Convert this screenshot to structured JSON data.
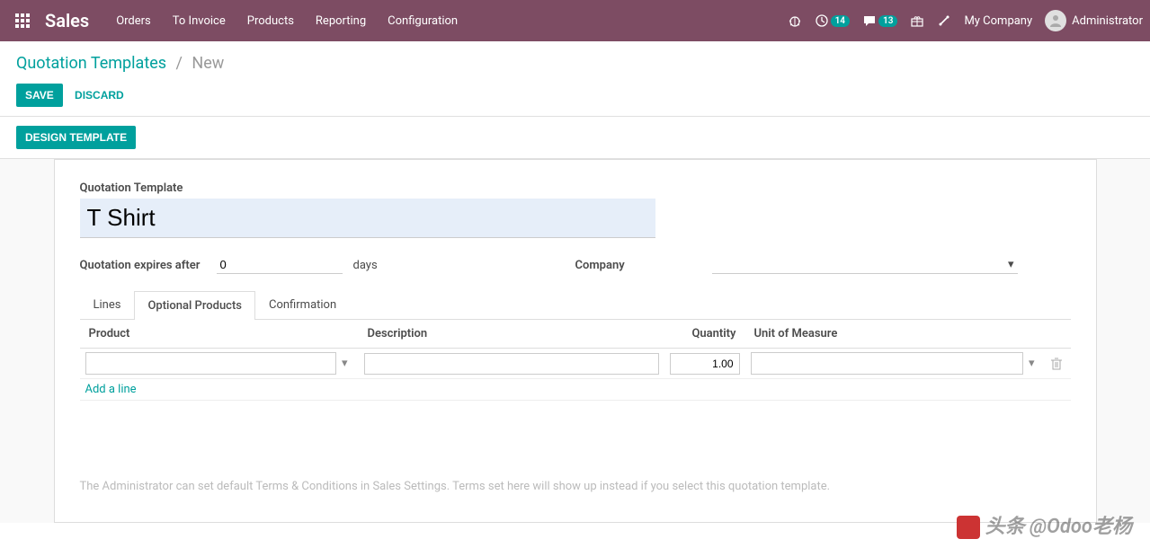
{
  "brand": "Sales",
  "nav": {
    "orders": "Orders",
    "to_invoice": "To Invoice",
    "products": "Products",
    "reporting": "Reporting",
    "configuration": "Configuration"
  },
  "tray": {
    "debug_badge": "",
    "activities_count": "14",
    "messages_count": "13",
    "company": "My Company",
    "user": "Administrator"
  },
  "breadcrumb": {
    "parent": "Quotation Templates",
    "current": "New"
  },
  "buttons": {
    "save": "SAVE",
    "discard": "DISCARD",
    "design": "DESIGN TEMPLATE"
  },
  "form": {
    "title_label": "Quotation Template",
    "title_value": "T Shirt",
    "expires_label": "Quotation expires after",
    "expires_value": "0",
    "expires_unit": "days",
    "company_label": "Company",
    "company_value": ""
  },
  "tabs": {
    "lines": "Lines",
    "optional": "Optional Products",
    "confirmation": "Confirmation"
  },
  "table": {
    "headers": {
      "product": "Product",
      "description": "Description",
      "quantity": "Quantity",
      "uom": "Unit of Measure"
    },
    "row": {
      "product": "",
      "description": "",
      "quantity": "1.00",
      "uom": ""
    },
    "add_line": "Add a line"
  },
  "terms_note": "The Administrator can set default Terms & Conditions in Sales Settings. Terms set here will show up instead if you select this quotation template.",
  "watermark": "头条 @Odoo老杨"
}
